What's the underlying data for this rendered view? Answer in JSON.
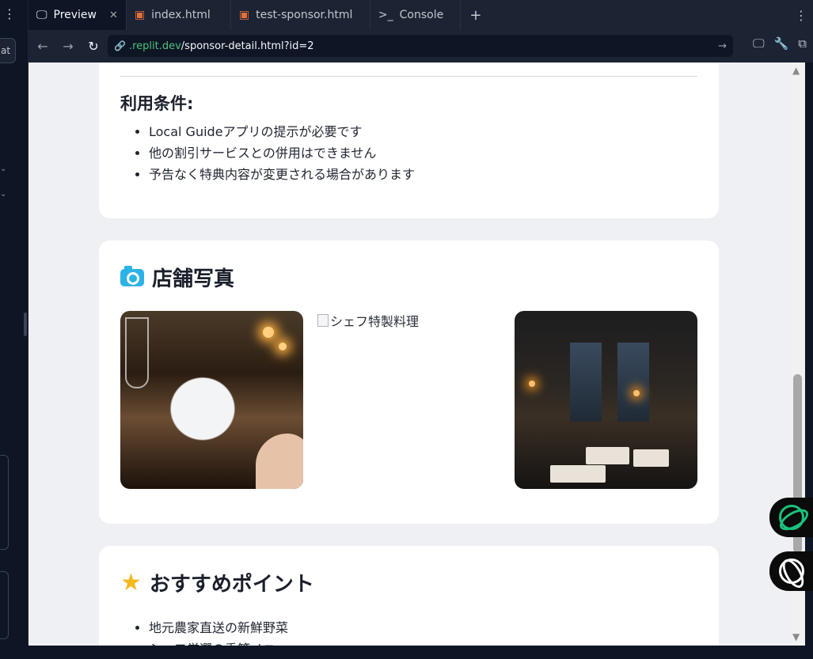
{
  "tabs": [
    {
      "label": "Preview",
      "icon": "monitor-icon",
      "active": true
    },
    {
      "label": "index.html",
      "icon": "html5-icon",
      "active": false
    },
    {
      "label": "test-sponsor.html",
      "icon": "html5-icon",
      "active": false
    },
    {
      "label": "Console",
      "icon": "terminal-icon",
      "active": false
    }
  ],
  "left_rail": {
    "chip_text": "at"
  },
  "url": {
    "host": ".replit.dev",
    "path": "/sponsor-detail.html?id=2"
  },
  "terms": {
    "title": "利用条件:",
    "items": [
      "Local Guideアプリの提示が必要です",
      "他の割引サービスとの併用はできません",
      "予告なく特典内容が変更される場合があります"
    ]
  },
  "photos": {
    "title": "店舗写真",
    "broken_alt": "シェフ特製料理"
  },
  "recommend": {
    "title": "おすすめポイント",
    "items": [
      "地元農家直送の新鮮野菜",
      "シェフ厳選の季節メニュー"
    ]
  },
  "colors": {
    "accent_green": "#4ec27c",
    "camera_blue": "#2bb3e6",
    "star_yellow": "#f6b81f"
  }
}
